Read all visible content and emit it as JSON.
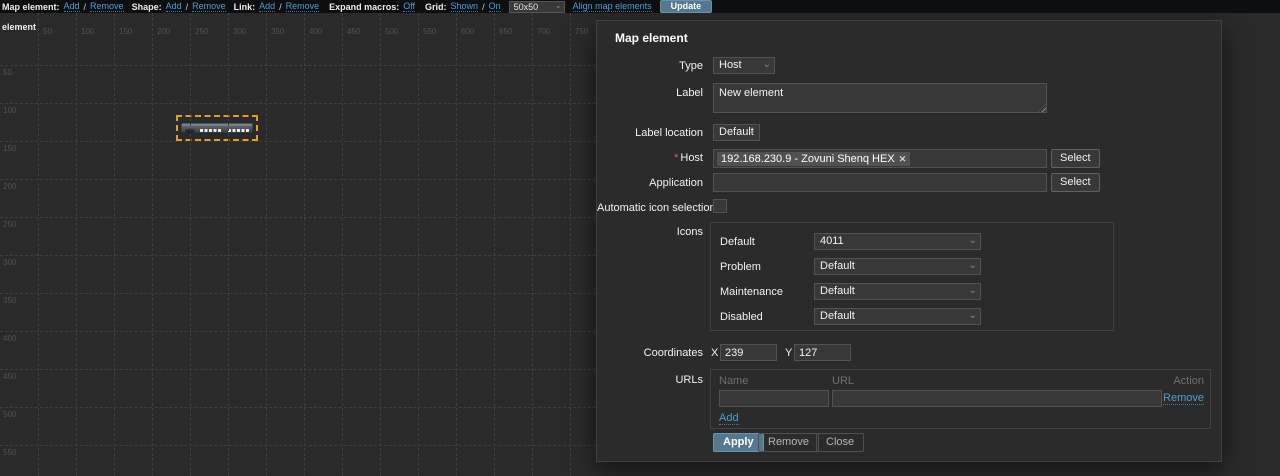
{
  "toolbar": {
    "map_element_label": "Map element:",
    "shape_label": "Shape:",
    "link_label": "Link:",
    "add_label": "Add",
    "remove_label": "Remove",
    "slash": "/",
    "expand_macros_label": "Expand macros:",
    "expand_macros_value": "Off",
    "grid_label": "Grid:",
    "grid_shown": "Shown",
    "grid_on": "On",
    "grid_size_value": "50x50",
    "align_label": "Align map elements",
    "update_label": "Update",
    "chevron": "⌄"
  },
  "canvas": {
    "corner_label": "element",
    "grid_spacing_px": 38,
    "x_ticks": [
      "50",
      "100",
      "150",
      "200",
      "250",
      "300",
      "350",
      "400",
      "450",
      "500",
      "550",
      "600",
      "650",
      "700",
      "750"
    ],
    "y_ticks": [
      "50",
      "100",
      "150",
      "200",
      "250",
      "300",
      "350",
      "400",
      "450",
      "500",
      "550"
    ]
  },
  "dialog": {
    "title": "Map element",
    "fields": {
      "type": {
        "label": "Type",
        "value": "Host"
      },
      "label": {
        "label": "Label",
        "value": "New element"
      },
      "label_location": {
        "label": "Label location",
        "value": "Default"
      },
      "host": {
        "label": "Host",
        "required_mark": "*",
        "chip": "192.168.230.9 - Zovuni Shenq HEX",
        "chip_remove": "✕",
        "select_button": "Select"
      },
      "application": {
        "label": "Application",
        "value": "",
        "select_button": "Select"
      },
      "auto_icon": {
        "label": "Automatic icon selection"
      },
      "icons": {
        "label": "Icons",
        "rows": [
          {
            "label": "Default",
            "value": "4011"
          },
          {
            "label": "Problem",
            "value": "Default"
          },
          {
            "label": "Maintenance",
            "value": "Default"
          },
          {
            "label": "Disabled",
            "value": "Default"
          }
        ]
      },
      "coordinates": {
        "label": "Coordinates",
        "x_label": "X",
        "x_value": "239",
        "y_label": "Y",
        "y_value": "127"
      },
      "urls": {
        "label": "URLs",
        "col_name": "Name",
        "col_url": "URL",
        "col_action": "Action",
        "name_value": "",
        "url_value": "",
        "remove_link": "Remove",
        "add_link": "Add"
      }
    },
    "buttons": {
      "apply": "Apply",
      "remove": "Remove",
      "close": "Close"
    },
    "chevron": "⌄"
  },
  "colors": {
    "link_blue": "#4f9fd4",
    "primary_button": "#55788f",
    "selection_orange": "#e09c33",
    "required_red": "#e45959",
    "canvas_bg": "#2a2a2a",
    "dialog_bg": "#2b2b2b",
    "input_bg": "#383838"
  }
}
